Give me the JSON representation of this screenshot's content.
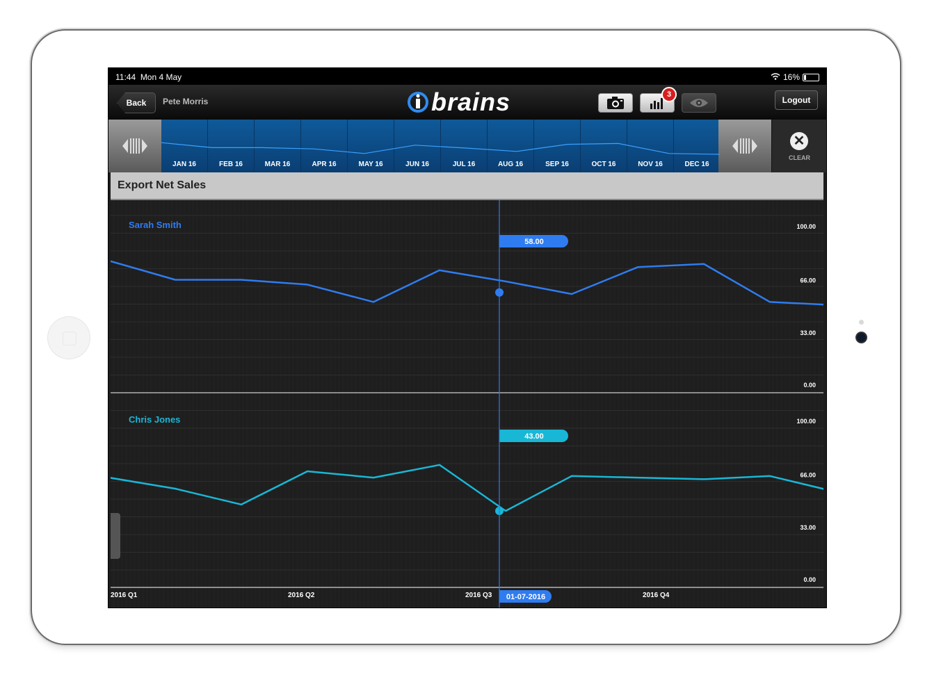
{
  "status": {
    "time": "11:44",
    "date": "Mon 4 May",
    "battery": "16%",
    "battery_fraction": 0.16
  },
  "topbar": {
    "back_label": "Back",
    "user_name": "Pete Morris",
    "logo_text": "brains",
    "camera_icon": "camera-icon",
    "charts_icon": "bar-chart-icon",
    "charts_badge": "3",
    "eye_icon": "eye-icon",
    "logout_label": "Logout"
  },
  "strip": {
    "months": [
      "JAN 16",
      "FEB 16",
      "MAR 16",
      "APR 16",
      "MAY 16",
      "JUN 16",
      "JUL 16",
      "AUG 16",
      "SEP 16",
      "OCT 16",
      "NOV 16",
      "DEC 16"
    ],
    "clear_label": "CLEAR"
  },
  "page": {
    "title": "Export Net Sales"
  },
  "colors": {
    "series1": "#2f7cf0",
    "series2": "#19b7d6",
    "cursor": "#2f7cf0"
  },
  "chart_data": [
    {
      "type": "line",
      "series": [
        {
          "name": "Sarah Smith",
          "values": [
            78,
            66,
            66,
            63,
            52,
            72,
            65,
            57,
            74,
            76,
            52,
            50
          ]
        }
      ],
      "ylim": [
        0,
        100
      ],
      "yticks": [
        "100.00",
        "66.00",
        "33.00",
        "0.00"
      ],
      "cursor_label": "58.00",
      "cursor_index": 5.5
    },
    {
      "type": "line",
      "series": [
        {
          "name": "Chris Jones",
          "values": [
            64,
            57,
            47,
            68,
            64,
            72,
            43,
            65,
            64,
            63,
            65,
            55
          ]
        }
      ],
      "ylim": [
        0,
        100
      ],
      "yticks": [
        "100.00",
        "66.00",
        "33.00",
        "0.00"
      ],
      "cursor_label": "43.00",
      "cursor_index": 5.5
    }
  ],
  "xaxis": {
    "labels": [
      "2016 Q1",
      "2016 Q2",
      "2016 Q3",
      "2016 Q4"
    ],
    "cursor_date": "01-07-2016"
  }
}
